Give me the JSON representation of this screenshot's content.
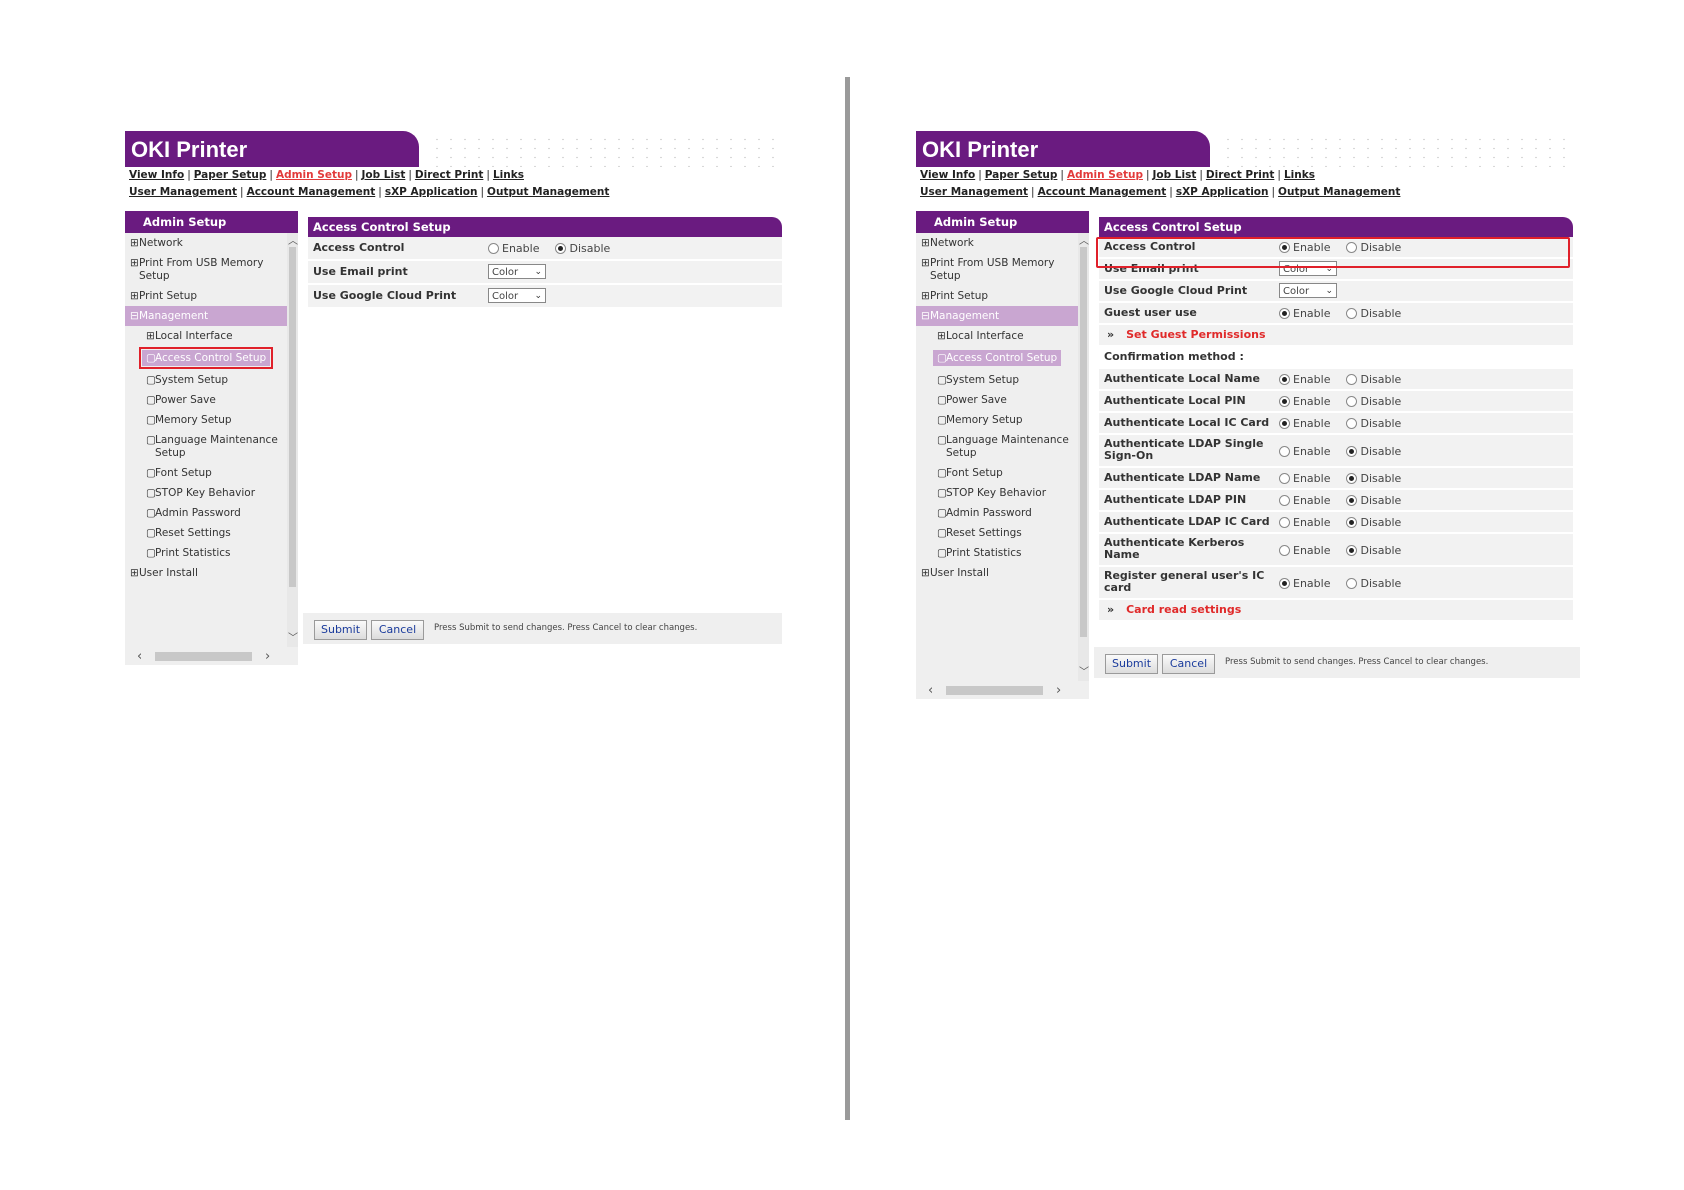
{
  "left": {
    "brand": "OKI Printer",
    "nav_row1": [
      "View Info",
      "Paper Setup",
      "Admin Setup",
      "Job List",
      "Direct Print",
      "Links"
    ],
    "nav_row2": [
      "User Management",
      "Account Management",
      "sXP Application",
      "Output Management"
    ],
    "sidebar_title": "Admin Setup",
    "sidebar": [
      {
        "sym": "⊞",
        "label": "Network"
      },
      {
        "sym": "⊞",
        "label": "Print From USB Memory"
      },
      {
        "sym": "",
        "label": "Setup"
      },
      {
        "sym": "⊞",
        "label": "Print Setup"
      },
      {
        "sym": "⊟",
        "label": "Management"
      },
      {
        "sym": "⊞",
        "label": "Local Interface"
      },
      {
        "sym": "▢",
        "label": "Access Control Setup"
      },
      {
        "sym": "▢",
        "label": "System Setup"
      },
      {
        "sym": "▢",
        "label": "Power Save"
      },
      {
        "sym": "▢",
        "label": "Memory Setup"
      },
      {
        "sym": "▢",
        "label": "Language Maintenance"
      },
      {
        "sym": "",
        "label": "Setup"
      },
      {
        "sym": "▢",
        "label": "Font Setup"
      },
      {
        "sym": "▢",
        "label": "STOP Key Behavior"
      },
      {
        "sym": "▢",
        "label": "Admin Password"
      },
      {
        "sym": "▢",
        "label": "Reset Settings"
      },
      {
        "sym": "▢",
        "label": "Print Statistics"
      },
      {
        "sym": "⊞",
        "label": "User Install"
      }
    ],
    "main_title": "Access Control Setup",
    "rows": {
      "access_control": {
        "label": "Access Control",
        "enable": "Enable",
        "disable": "Disable",
        "selected": "Disable"
      },
      "email_print": {
        "label": "Use Email print",
        "value": "Color"
      },
      "cloud_print": {
        "label": "Use Google Cloud Print",
        "value": "Color"
      }
    },
    "submit": "Submit",
    "cancel": "Cancel",
    "footnote": "Press Submit to send changes. Press Cancel to clear changes."
  },
  "right": {
    "brand": "OKI Printer",
    "nav_row1": [
      "View Info",
      "Paper Setup",
      "Admin Setup",
      "Job List",
      "Direct Print",
      "Links"
    ],
    "nav_row2": [
      "User Management",
      "Account Management",
      "sXP Application",
      "Output Management"
    ],
    "sidebar_title": "Admin Setup",
    "sidebar": [
      {
        "sym": "⊞",
        "label": "Network"
      },
      {
        "sym": "⊞",
        "label": "Print From USB Memory"
      },
      {
        "sym": "",
        "label": "Setup"
      },
      {
        "sym": "⊞",
        "label": "Print Setup"
      },
      {
        "sym": "⊟",
        "label": "Management"
      },
      {
        "sym": "⊞",
        "label": "Local Interface"
      },
      {
        "sym": "▢",
        "label": "Access Control Setup"
      },
      {
        "sym": "▢",
        "label": "System Setup"
      },
      {
        "sym": "▢",
        "label": "Power Save"
      },
      {
        "sym": "▢",
        "label": "Memory Setup"
      },
      {
        "sym": "▢",
        "label": "Language Maintenance"
      },
      {
        "sym": "",
        "label": "Setup"
      },
      {
        "sym": "▢",
        "label": "Font Setup"
      },
      {
        "sym": "▢",
        "label": "STOP Key Behavior"
      },
      {
        "sym": "▢",
        "label": "Admin Password"
      },
      {
        "sym": "▢",
        "label": "Reset Settings"
      },
      {
        "sym": "▢",
        "label": "Print Statistics"
      },
      {
        "sym": "⊞",
        "label": "User Install"
      }
    ],
    "main_title": "Access Control Setup",
    "enable": "Enable",
    "disable": "Disable",
    "rows": [
      {
        "kind": "radio",
        "label": "Access Control",
        "label2": "",
        "selected": "Enable"
      },
      {
        "kind": "select",
        "label": "Use Email print",
        "label2": "",
        "value": "Color"
      },
      {
        "kind": "select",
        "label": "Use Google Cloud Print",
        "label2": "",
        "value": "Color"
      },
      {
        "kind": "radio",
        "label": "Guest user use",
        "label2": "",
        "selected": "Enable"
      },
      {
        "kind": "link",
        "label": "Set Guest Permissions",
        "label2": ""
      },
      {
        "kind": "plain",
        "label": "Confirmation method :",
        "label2": ""
      },
      {
        "kind": "radio",
        "label": "Authenticate Local Name",
        "label2": "",
        "selected": "Enable"
      },
      {
        "kind": "radio",
        "label": "Authenticate Local PIN",
        "label2": "",
        "selected": "Enable"
      },
      {
        "kind": "radio",
        "label": "Authenticate Local IC Card",
        "label2": "",
        "selected": "Enable"
      },
      {
        "kind": "radio",
        "label": "Authenticate LDAP Single",
        "label2": "Sign-On",
        "selected": "Disable"
      },
      {
        "kind": "radio",
        "label": "Authenticate LDAP Name",
        "label2": "",
        "selected": "Disable"
      },
      {
        "kind": "radio",
        "label": "Authenticate LDAP PIN",
        "label2": "",
        "selected": "Disable"
      },
      {
        "kind": "radio",
        "label": "Authenticate LDAP IC Card",
        "label2": "",
        "selected": "Disable"
      },
      {
        "kind": "radio",
        "label": "Authenticate Kerberos",
        "label2": "Name",
        "selected": "Disable"
      },
      {
        "kind": "radio",
        "label": "Register general user's IC",
        "label2": "card",
        "selected": "Enable"
      },
      {
        "kind": "link",
        "label": "Card read settings",
        "label2": ""
      }
    ],
    "submit": "Submit",
    "cancel": "Cancel",
    "footnote": "Press Submit to send changes. Press Cancel to clear changes."
  },
  "colors": {
    "brand": "#6a1b80",
    "highlight": "#c9a6d1",
    "callout": "#e0202a",
    "active_link": "#e23a3a"
  }
}
